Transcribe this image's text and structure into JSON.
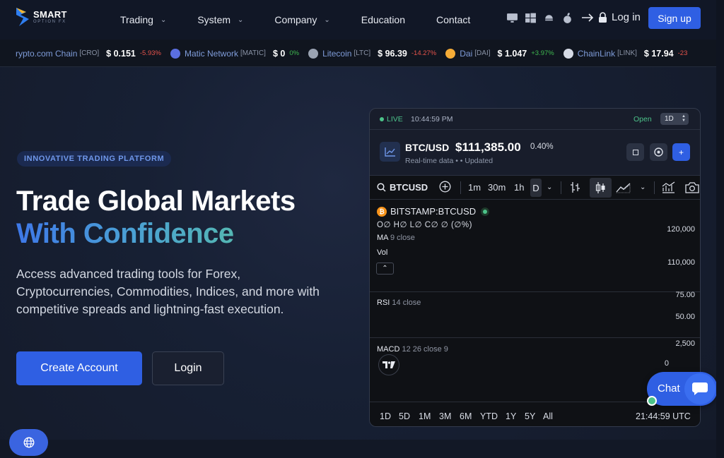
{
  "brand": {
    "name_line1": "SMART",
    "name_line2": "OPTION FX"
  },
  "nav": {
    "items": [
      {
        "label": "Trading",
        "dropdown": true
      },
      {
        "label": "System",
        "dropdown": true
      },
      {
        "label": "Company",
        "dropdown": true
      },
      {
        "label": "Education",
        "dropdown": false
      },
      {
        "label": "Contact",
        "dropdown": false
      }
    ],
    "platform_icons": [
      "desktop-icon",
      "windows-icon",
      "android-icon",
      "apple-icon"
    ],
    "login_label": "Log in",
    "signup_label": "Sign up"
  },
  "ticker": [
    {
      "name": "rypto.com Chain",
      "symbol": "[CRO]",
      "price": "$ 0.151",
      "change": "-5.93%",
      "direction": "down",
      "icon": "cronos-icon",
      "icon_color": "#1f3a7a"
    },
    {
      "name": "Matic Network",
      "symbol": "[MATIC]",
      "price": "$ 0",
      "change": "0%",
      "direction": "up",
      "icon": "matic-icon",
      "icon_color": "#5b6fe0"
    },
    {
      "name": "Litecoin",
      "symbol": "[LTC]",
      "price": "$ 96.39",
      "change": "-14.27%",
      "direction": "down",
      "icon": "litecoin-icon",
      "icon_color": "#9aa3b2"
    },
    {
      "name": "Dai",
      "symbol": "[DAI]",
      "price": "$ 1.047",
      "change": "+3.97%",
      "direction": "up",
      "icon": "dai-icon",
      "icon_color": "#f5ac37"
    },
    {
      "name": "ChainLink",
      "symbol": "[LINK]",
      "price": "$ 17.94",
      "change": "-23",
      "direction": "down",
      "icon": "chainlink-icon",
      "icon_color": "#d6dbe6"
    }
  ],
  "hero": {
    "badge": "INNOVATIVE TRADING PLATFORM",
    "title_line1": "Trade Global Markets",
    "title_line2": "With Confidence",
    "subtitle": "Access advanced trading tools for Forex, Cryptocurrencies, Commodities, Indices, and more with competitive spreads and lightning-fast execution.",
    "primary_cta": "Create Account",
    "secondary_cta": "Login"
  },
  "widget": {
    "live_label": "LIVE",
    "time": "10:44:59 PM",
    "status": "Open",
    "timeframe": "1D",
    "pair": "BTC/USD",
    "price": "$111,385.00",
    "change_pct": "0.40%",
    "meta": "Real-time data •  • Updated",
    "chart": {
      "symbol_search": "BTCUSD",
      "intervals": [
        "1m",
        "30m",
        "1h",
        "D"
      ],
      "legend_symbol": "BITSTAMP:BTCUSD",
      "ohlc": "O∅ H∅ L∅ C∅ ∅ (∅%)",
      "ma_name": "MA",
      "ma_params": "9 close",
      "vol_label": "Vol",
      "price_axis": [
        "120,000",
        "110,000"
      ],
      "rsi_name": "RSI",
      "rsi_params": "14 close",
      "rsi_axis": [
        "75.00",
        "50.00"
      ],
      "macd_name": "MACD",
      "macd_params": "12 26 close 9",
      "macd_axis": [
        "2,500",
        "0"
      ],
      "ranges": [
        "1D",
        "5D",
        "1M",
        "3M",
        "6M",
        "YTD",
        "1Y",
        "5Y",
        "All"
      ],
      "utc_time": "21:44:59 UTC"
    }
  },
  "chat": {
    "label": "Chat"
  },
  "colors": {
    "accent": "#2f5fe3",
    "positive": "#3fb950",
    "negative": "#e5534b",
    "live": "#4cc38a"
  }
}
